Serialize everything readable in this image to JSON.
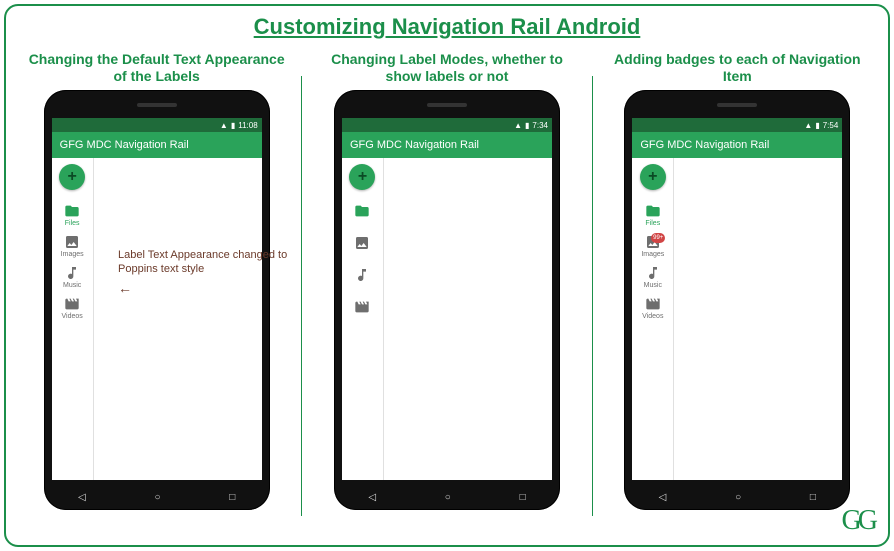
{
  "title": "Customizing Navigation Rail Android",
  "logo": "GG",
  "columns": [
    {
      "caption": "Changing the Default Text Appearance of the Labels"
    },
    {
      "caption": "Changing Label Modes, whether to show labels or not"
    },
    {
      "caption": "Adding badges to each of Navigation Item"
    }
  ],
  "status": {
    "signal": "▲",
    "batt": "▮",
    "time1": "11:08",
    "time2": "7:34",
    "time3": "7:54"
  },
  "app": {
    "title": "GFG MDC Navigation Rail",
    "fab": "+"
  },
  "navitems": {
    "files": "Files",
    "images": "Images",
    "music": "Music",
    "videos": "Videos"
  },
  "badges": {
    "images": "99+"
  },
  "annotation": "Label Text Appearance changed to Poppins text style",
  "navbtns": {
    "back": "◁",
    "home": "○",
    "recent": "□"
  }
}
